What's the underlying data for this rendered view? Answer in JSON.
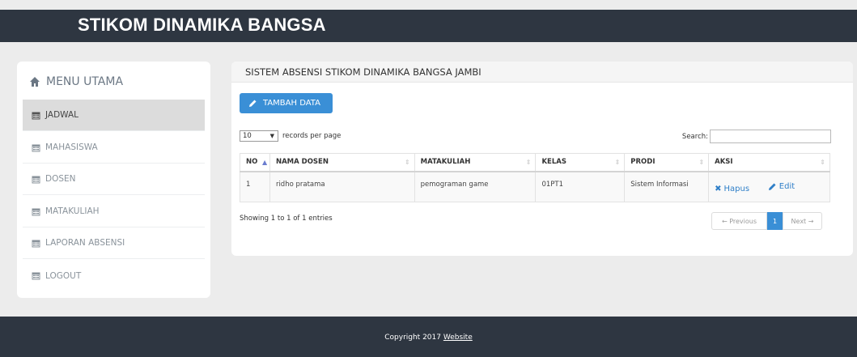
{
  "header": {
    "brand": "STIKOM DINAMIKA BANGSA"
  },
  "sidebar": {
    "title": "MENU UTAMA",
    "items": [
      {
        "label": "JADWAL"
      },
      {
        "label": "MAHASISWA"
      },
      {
        "label": "DOSEN"
      },
      {
        "label": "MATAKULIAH"
      },
      {
        "label": "LAPORAN ABSENSI"
      },
      {
        "label": "LOGOUT"
      }
    ]
  },
  "panel": {
    "title": "SISTEM ABSENSI STIKOM DINAMIKA BANGSA JAMBI",
    "add_button": "TAMBAH DATA",
    "length_value": "10",
    "length_suffix": "records per page",
    "search_label": "Search:",
    "search_value": "",
    "columns": [
      "NO",
      "NAMA DOSEN",
      "MATAKULIAH",
      "KELAS",
      "PRODI",
      "AKSI"
    ],
    "rows": [
      {
        "no": "1",
        "nama_dosen": "ridho pratama",
        "matakuliah": "pemograman game",
        "kelas": "01PT1",
        "prodi": "Sistem Informasi",
        "hapus": "Hapus",
        "edit": "Edit"
      }
    ],
    "info": "Showing 1 to 1 of 1 entries",
    "pagination": {
      "prev": "← Previous",
      "current": "1",
      "next": "Next →"
    }
  },
  "footer": {
    "text": "Copyright 2017",
    "link": "Website"
  },
  "colors": {
    "accent": "#3a8fd6",
    "topbar": "#2e3641",
    "background": "#ececec"
  }
}
